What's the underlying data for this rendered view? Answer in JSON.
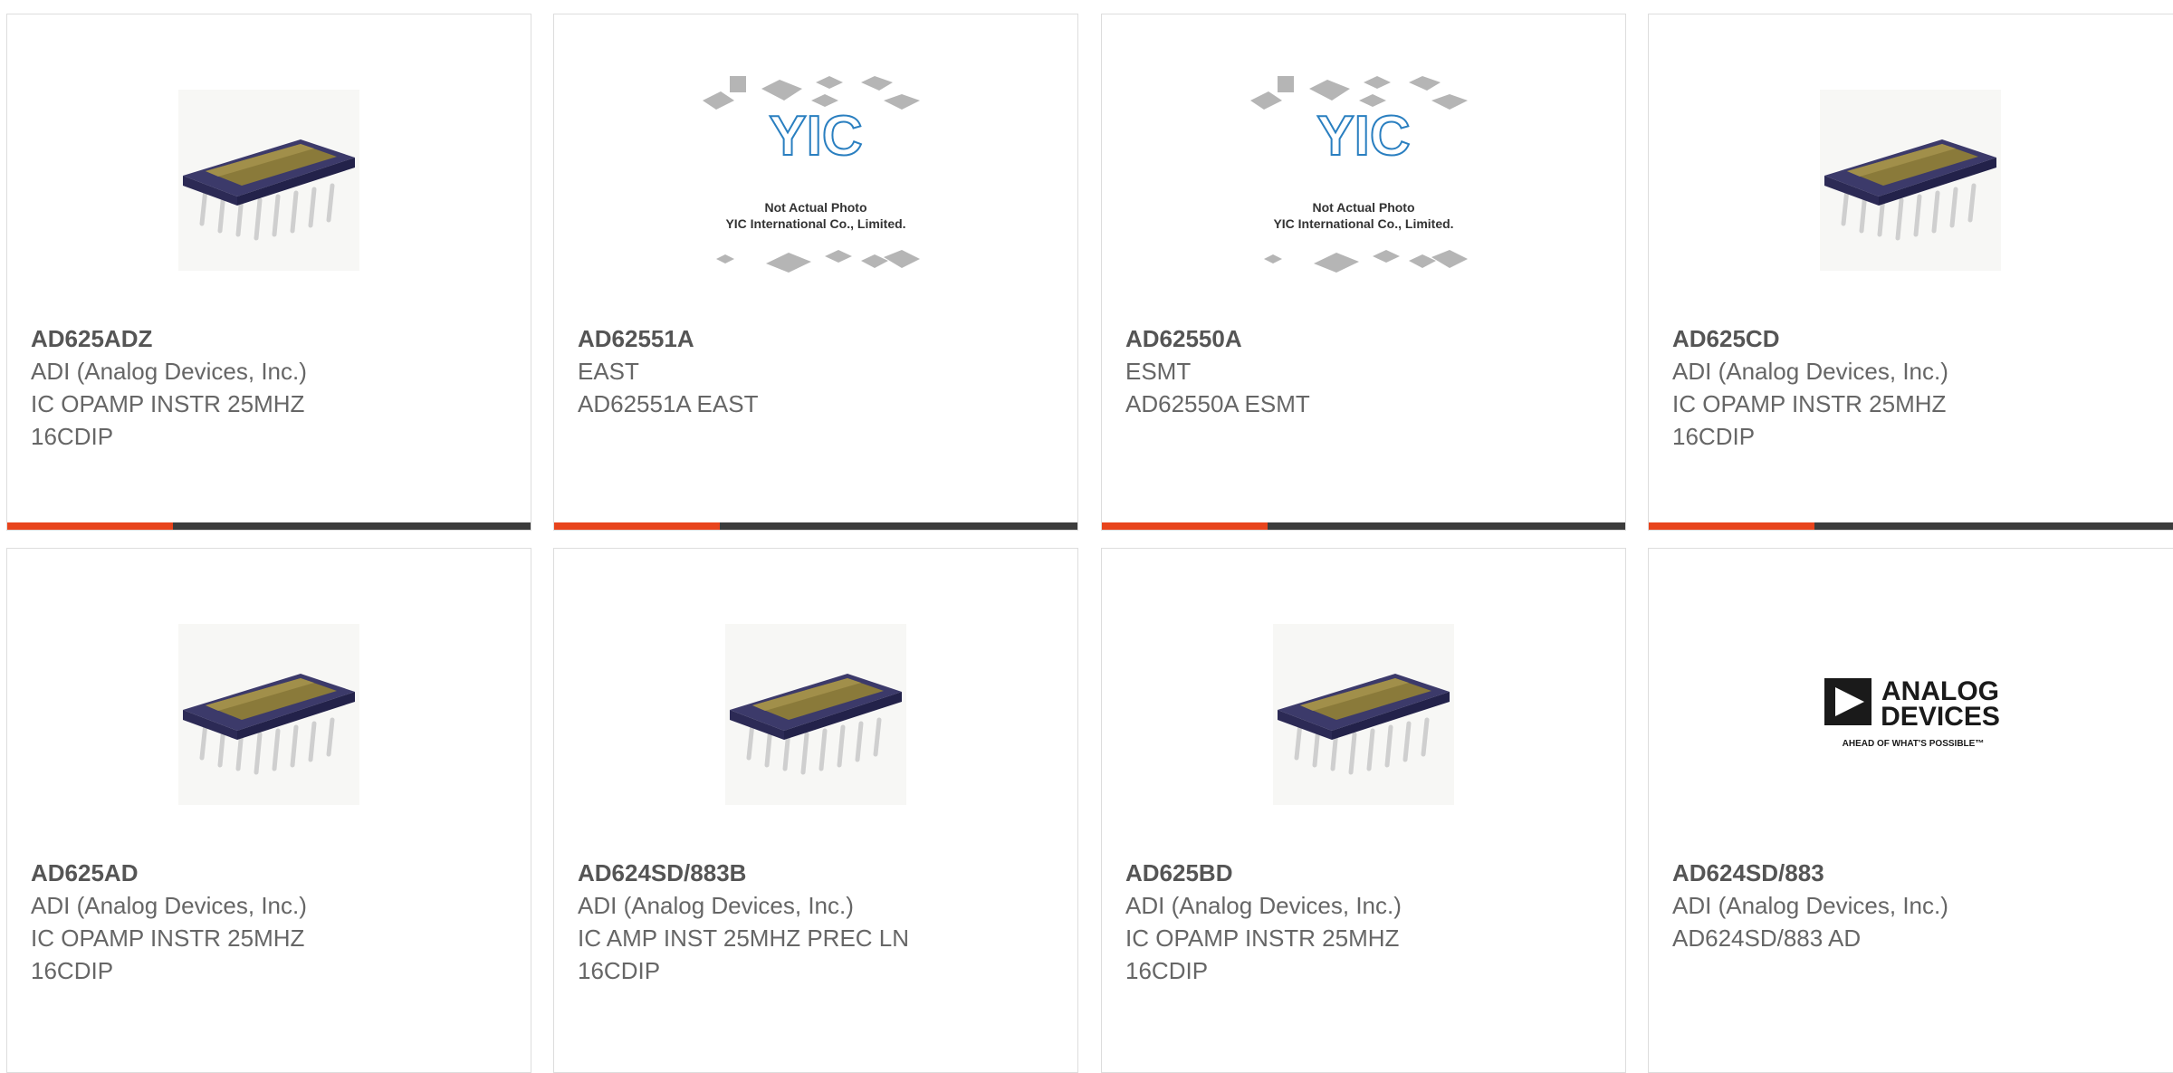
{
  "colors": {
    "accent": "#e8441c",
    "bar": "#3c3c3c",
    "border": "#dddddd"
  },
  "products": [
    {
      "part": "AD625ADZ",
      "maker": "ADI (Analog Devices, Inc.)",
      "desc1": "IC OPAMP INSTR 25MHZ",
      "desc2": "16CDIP",
      "image": "dip-chip"
    },
    {
      "part": "AD62551A",
      "maker": "EAST",
      "desc1": "AD62551A EAST",
      "desc2": "",
      "image": "yic-placeholder"
    },
    {
      "part": "AD62550A",
      "maker": "ESMT",
      "desc1": "AD62550A ESMT",
      "desc2": "",
      "image": "yic-placeholder"
    },
    {
      "part": "AD625CD",
      "maker": "ADI (Analog Devices, Inc.)",
      "desc1": "IC OPAMP INSTR 25MHZ",
      "desc2": "16CDIP",
      "image": "dip-chip"
    },
    {
      "part": "AD625AD",
      "maker": "ADI (Analog Devices, Inc.)",
      "desc1": "IC OPAMP INSTR 25MHZ",
      "desc2": "16CDIP",
      "image": "dip-chip"
    },
    {
      "part": "AD624SD/883B",
      "maker": "ADI (Analog Devices, Inc.)",
      "desc1": "IC AMP INST 25MHZ PREC LN",
      "desc2": "16CDIP",
      "image": "dip-chip"
    },
    {
      "part": "AD625BD",
      "maker": "ADI (Analog Devices, Inc.)",
      "desc1": "IC OPAMP INSTR 25MHZ",
      "desc2": "16CDIP",
      "image": "dip-chip"
    },
    {
      "part": "AD624SD/883",
      "maker": "ADI (Analog Devices, Inc.)",
      "desc1": "AD624SD/883 AD",
      "desc2": "",
      "image": "analog-devices-logo"
    }
  ],
  "placeholder": {
    "brand": "YIC",
    "caption1": "Not Actual Photo",
    "caption2": "YIC International Co., Limited."
  },
  "logo": {
    "word1": "ANALOG",
    "word2": "DEVICES",
    "tagline": "AHEAD OF WHAT'S POSSIBLE™"
  }
}
